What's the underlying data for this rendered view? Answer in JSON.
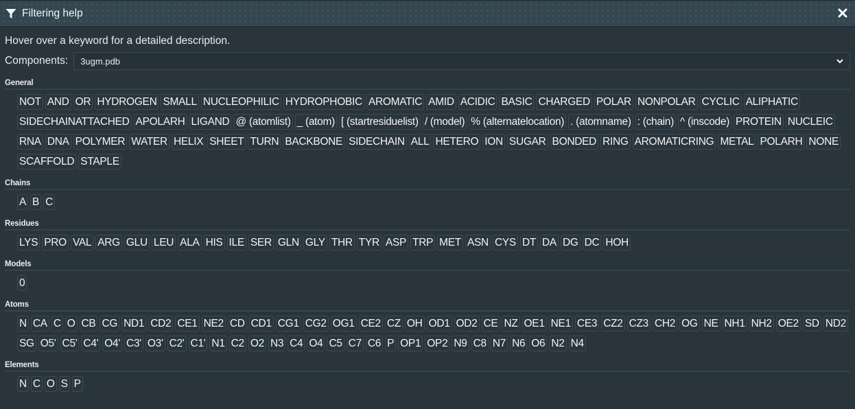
{
  "window": {
    "title": "Filtering help",
    "icon": "filter-funnel-icon",
    "close_icon": "close-icon"
  },
  "intro_text": "Hover over a keyword for a detailed description.",
  "components": {
    "label": "Components:",
    "selected": "3ugm.pdb"
  },
  "sections": [
    {
      "title": "General",
      "items": [
        "NOT",
        "AND",
        "OR",
        "HYDROGEN",
        "SMALL",
        "NUCLEOPHILIC",
        "HYDROPHOBIC",
        "AROMATIC",
        "AMID",
        "ACIDIC",
        "BASIC",
        "CHARGED",
        "POLAR",
        "NONPOLAR",
        "CYCLIC",
        "ALIPHATIC",
        "SIDECHAINATTACHED",
        "APOLARH",
        "LIGAND",
        "@ (atomlist)",
        "_ (atom)",
        "[ (startresiduelist)",
        "/ (model)",
        "% (alternatelocation)",
        ". (atomname)",
        ": (chain)",
        "^ (inscode)",
        "PROTEIN",
        "NUCLEIC",
        "RNA",
        "DNA",
        "POLYMER",
        "WATER",
        "HELIX",
        "SHEET",
        "TURN",
        "BACKBONE",
        "SIDECHAIN",
        "ALL",
        "HETERO",
        "ION",
        "SUGAR",
        "BONDED",
        "RING",
        "AROMATICRING",
        "METAL",
        "POLARH",
        "NONE",
        "SCAFFOLD",
        "STAPLE"
      ]
    },
    {
      "title": "Chains",
      "items": [
        "A",
        "B",
        "C"
      ]
    },
    {
      "title": "Residues",
      "items": [
        "LYS",
        "PRO",
        "VAL",
        "ARG",
        "GLU",
        "LEU",
        "ALA",
        "HIS",
        "ILE",
        "SER",
        "GLN",
        "GLY",
        "THR",
        "TYR",
        "ASP",
        "TRP",
        "MET",
        "ASN",
        "CYS",
        "DT",
        "DA",
        "DG",
        "DC",
        "HOH"
      ]
    },
    {
      "title": "Models",
      "items": [
        "0"
      ]
    },
    {
      "title": "Atoms",
      "items": [
        "N",
        "CA",
        "C",
        "O",
        "CB",
        "CG",
        "ND1",
        "CD2",
        "CE1",
        "NE2",
        "CD",
        "CD1",
        "CG1",
        "CG2",
        "OG1",
        "CE2",
        "CZ",
        "OH",
        "OD1",
        "OD2",
        "CE",
        "NZ",
        "OE1",
        "NE1",
        "CE3",
        "CZ2",
        "CZ3",
        "CH2",
        "OG",
        "NE",
        "NH1",
        "NH2",
        "OE2",
        "SD",
        "ND2",
        "SG",
        "O5'",
        "C5'",
        "C4'",
        "O4'",
        "C3'",
        "O3'",
        "C2'",
        "C1'",
        "N1",
        "C2",
        "O2",
        "N3",
        "C4",
        "O4",
        "C5",
        "C7",
        "C6",
        "P",
        "OP1",
        "OP2",
        "N9",
        "C8",
        "N7",
        "N6",
        "O6",
        "N2",
        "N4"
      ]
    },
    {
      "title": "Elements",
      "items": [
        "N",
        "C",
        "O",
        "S",
        "P"
      ]
    }
  ]
}
